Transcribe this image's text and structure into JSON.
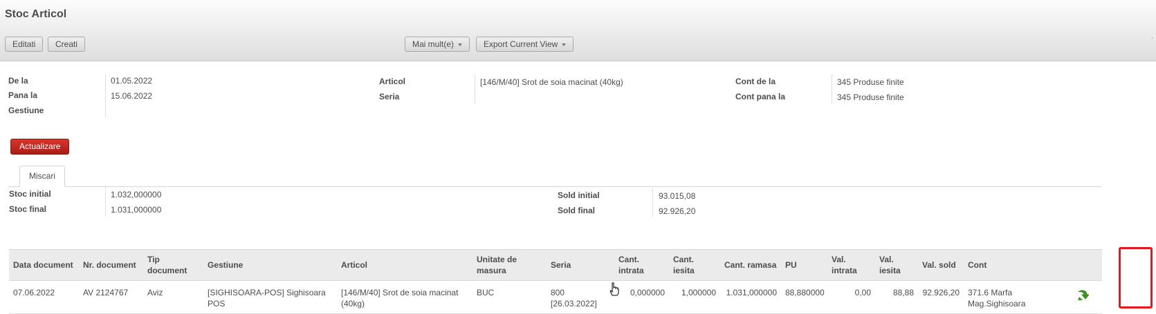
{
  "page": {
    "title": "Stoc Articol"
  },
  "toolbar": {
    "edit_label": "Editati",
    "create_label": "Creati",
    "more_label": "Mai mult(e)",
    "export_label": "Export Current View"
  },
  "filters": {
    "from_label": "De la",
    "from_value": "01.05.2022",
    "to_label": "Pana la",
    "to_value": "15.06.2022",
    "warehouse_label": "Gestiune",
    "warehouse_value": "",
    "article_label": "Articol",
    "article_value": "[146/M/40] Srot de soia macinat (40kg)",
    "series_label": "Seria",
    "series_value": "",
    "account_from_label": "Cont de la",
    "account_from_value": "345 Produse finite",
    "account_to_label": "Cont pana la",
    "account_to_value": "345 Produse finite"
  },
  "update_label": "Actualizare",
  "tabs": [
    {
      "label": "Miscari"
    }
  ],
  "summary": {
    "initial_stock_label": "Stoc initial",
    "initial_stock_value": "1.032,000000",
    "final_stock_label": "Stoc final",
    "final_stock_value": "1.031,000000",
    "initial_balance_label": "Sold initial",
    "initial_balance_value": "93.015,08",
    "final_balance_label": "Sold final",
    "final_balance_value": "92.926,20"
  },
  "table": {
    "columns": [
      "Data document",
      "Nr. document",
      "Tip document",
      "Gestiune",
      "Articol",
      "Unitate de masura",
      "Seria",
      "Cant. intrata",
      "Cant. iesita",
      "Cant. ramasa",
      "PU",
      "Val. intrata",
      "Val. iesita",
      "Val. sold",
      "Cont",
      ""
    ],
    "rows": [
      {
        "date": "07.06.2022",
        "doc_no": "AV 2124767",
        "doc_type": "Aviz",
        "warehouse": "[SIGHISOARA-POS] Sighisoara POS",
        "article": "[146/M/40] Srot de soia macinat (40kg)",
        "unit": "BUC",
        "series": "800 [26.03.2022]",
        "qty_in": "0,000000",
        "qty_out": "1,000000",
        "qty_remaining": "1.031,000000",
        "unit_price": "88,880000",
        "val_in": "0,00",
        "val_out": "88,88",
        "val_balance": "92.926,20",
        "account": "371.6 Marfa Mag.Sighisoara"
      }
    ]
  },
  "icons": {
    "row_action": "green-arrow-open-icon",
    "cursor": "hand-pointer-icon"
  },
  "colors": {
    "update_button": "#c0261f",
    "highlight": "#e8161c",
    "action_icon": "#3c9a16"
  }
}
